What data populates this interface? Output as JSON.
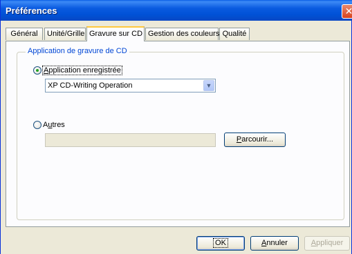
{
  "window": {
    "title": "Préférences"
  },
  "tabs": [
    {
      "label": "Général"
    },
    {
      "label": "Unité/Grille"
    },
    {
      "label": "Gravure sur CD"
    },
    {
      "label": "Gestion des couleurs"
    },
    {
      "label": "Qualité"
    }
  ],
  "active_tab": "Gravure sur CD",
  "group": {
    "legend": "Application de gravure de CD",
    "registered": {
      "label_pre": "",
      "label_accel": "A",
      "label_post": "pplication enregistrée",
      "checked": true,
      "select_value": "XP CD-Writing Operation"
    },
    "others": {
      "label_pre": "A",
      "label_accel": "u",
      "label_post": "tres",
      "checked": false,
      "path_value": "",
      "browse_accel": "P",
      "browse_rest": "arcourir..."
    }
  },
  "buttons": {
    "ok": "OK",
    "cancel_accel": "A",
    "cancel_rest": "nnuler",
    "apply_accel": "A",
    "apply_rest": "ppliquer"
  },
  "colors": {
    "titlebar": "#0054e3",
    "accent": "#0046d5",
    "tab_highlight": "#ffc83c"
  }
}
